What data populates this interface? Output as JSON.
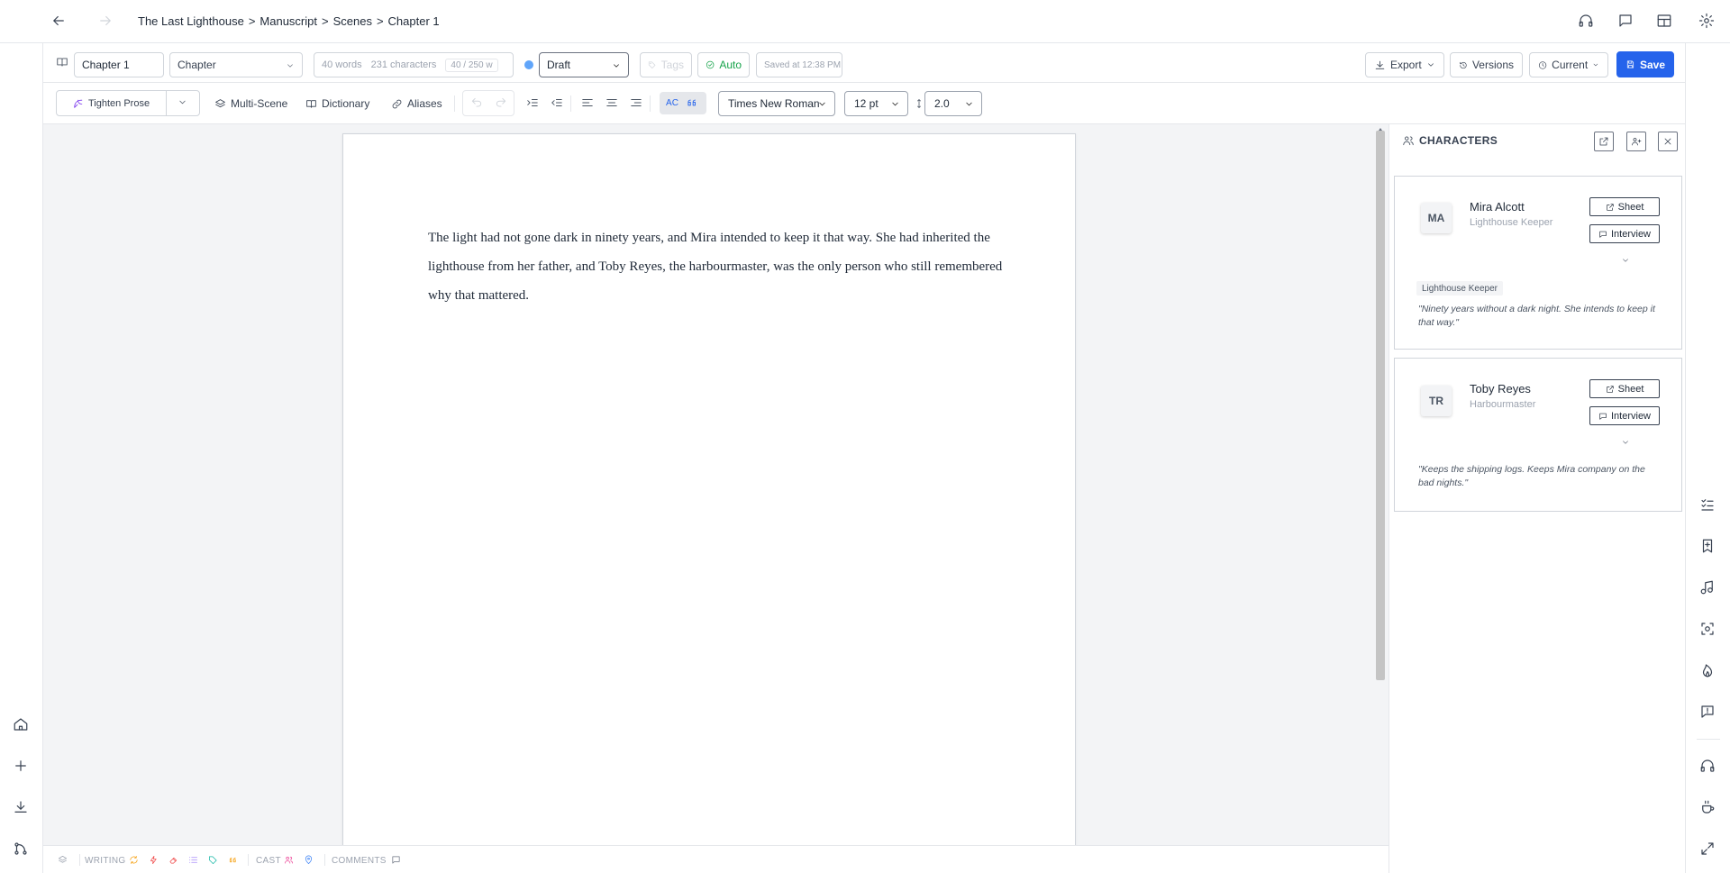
{
  "breadcrumb": [
    "The Last Lighthouse",
    "Manuscript",
    "Scenes",
    "Chapter 1"
  ],
  "toolbar": {
    "chapter_name": "Chapter 1",
    "chapter_type": "Chapter",
    "word_count": "40 words",
    "char_count": "231 characters",
    "word_target": "40 / 250 w",
    "status": "Draft",
    "tags_placeholder": "Tags",
    "auto_label": "Auto",
    "saved_text": "Saved at 12:38 PM",
    "export_label": "Export",
    "versions_label": "Versions",
    "current_label": "Current",
    "save_label": "Save",
    "status_color": "#60a5fa"
  },
  "format_toolbar": {
    "tighten_label": "Tighten Prose",
    "multiscene_label": "Multi-Scene",
    "dictionary_label": "Dictionary",
    "aliases_label": "Aliases",
    "autocorrect_label": "AC",
    "font_family": "Times New Roman",
    "font_size": "12 pt",
    "line_spacing": "2.0"
  },
  "editor": {
    "text": "The light had not gone dark in ninety years, and Mira intended to keep it that way. She had inherited the lighthouse from her father, and Toby Reyes, the harbourmaster, was the only person who still remembered why that mattered."
  },
  "statusbar": {
    "writing_label": "WRITING",
    "cast_label": "CAST",
    "comments_label": "COMMENTS"
  },
  "characters_panel": {
    "title": "CHARACTERS",
    "sheet_label": "Sheet",
    "interview_label": "Interview",
    "characters": [
      {
        "initials": "MA",
        "name": "Mira Alcott",
        "role": "Lighthouse Keeper",
        "tag": "Lighthouse Keeper",
        "quote": "\"Ninety years without a dark night. She intends to keep it that way.\""
      },
      {
        "initials": "TR",
        "name": "Toby Reyes",
        "role": "Harbourmaster",
        "quote": "\"Keeps the shipping logs. Keeps Mira company on the bad nights.\""
      }
    ]
  },
  "colors": {
    "accent": "#2563eb",
    "auto_green": "#16a34a",
    "writing_orange": "#f59e0b",
    "writing_pink": "#ef4444",
    "writing_purple": "#a78bfa",
    "writing_teal": "#14b8a6",
    "cast_pink": "#ec4899",
    "cast_blue": "#3b82f6"
  }
}
